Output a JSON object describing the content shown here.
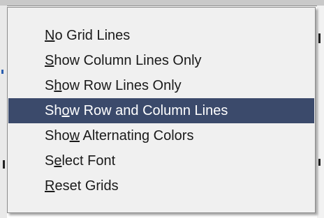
{
  "context_menu": {
    "items": [
      {
        "pre": "",
        "key": "N",
        "post": "o Grid Lines",
        "highlighted": false
      },
      {
        "pre": "",
        "key": "S",
        "post": "how Column Lines Only",
        "highlighted": false
      },
      {
        "pre": "S",
        "key": "h",
        "post": "ow Row Lines Only",
        "highlighted": false
      },
      {
        "pre": "Sh",
        "key": "o",
        "post": "w Row and Column Lines",
        "highlighted": true
      },
      {
        "pre": "Sho",
        "key": "w",
        "post": " Alternating Colors",
        "highlighted": false
      },
      {
        "pre": "S",
        "key": "e",
        "post": "lect Font",
        "highlighted": false
      },
      {
        "pre": "",
        "key": "R",
        "post": "eset Grids",
        "highlighted": false
      }
    ],
    "highlight_color": "#3b4a6b",
    "background_color": "#f0f0f0"
  }
}
